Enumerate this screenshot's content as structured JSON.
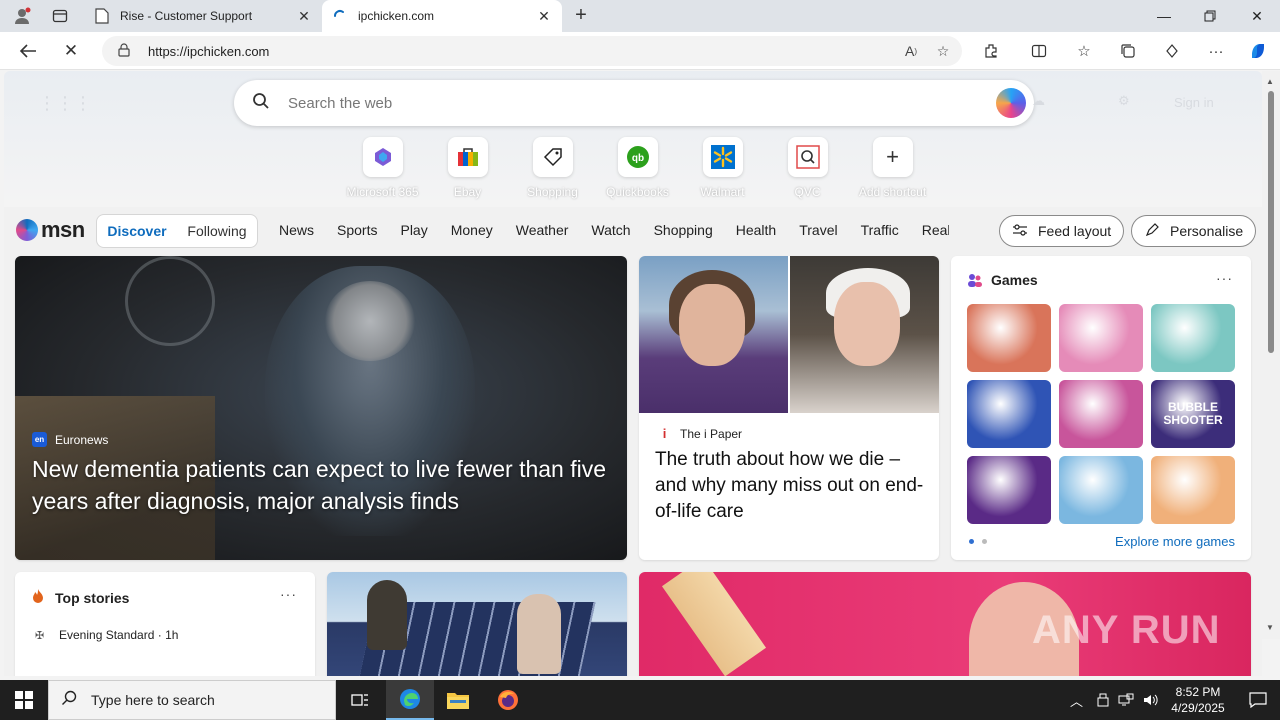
{
  "browser": {
    "tabs": [
      {
        "title": "Rise - Customer Support",
        "active": false
      },
      {
        "title": "ipchicken.com",
        "active": true
      }
    ],
    "url": "https://ipchicken.com"
  },
  "newtab": {
    "search_placeholder": "Search the web",
    "weather_faded": "Sign in",
    "shortcuts": [
      {
        "label": "Microsoft 365",
        "icon": "microsoft365-icon"
      },
      {
        "label": "Ebay",
        "icon": "ebay-icon"
      },
      {
        "label": "Shopping",
        "icon": "shopping-tag-icon"
      },
      {
        "label": "Quickbooks",
        "icon": "quickbooks-icon"
      },
      {
        "label": "Walmart",
        "icon": "walmart-icon"
      },
      {
        "label": "QVC",
        "icon": "qvc-icon"
      },
      {
        "label": "Add shortcut",
        "icon": "plus-icon"
      }
    ]
  },
  "msn": {
    "logo_text": "msn",
    "toggle": [
      "Discover",
      "Following"
    ],
    "nav": [
      "News",
      "Sports",
      "Play",
      "Money",
      "Weather",
      "Watch",
      "Shopping",
      "Health",
      "Travel",
      "Traffic",
      "Real E"
    ],
    "feed_layout": "Feed layout",
    "personalise": "Personalise"
  },
  "cards": {
    "hero": {
      "source": "Euronews",
      "title": "New dementia patients can expect to live fewer than five years after diagnosis, major analysis finds"
    },
    "ipaper": {
      "source": "The i Paper",
      "title": "The truth about how we die – and why many miss out on end-of-life care"
    },
    "games": {
      "title": "Games",
      "tiles": [
        {
          "label": "",
          "color": "#d9745a"
        },
        {
          "label": "",
          "color": "#e58bb8"
        },
        {
          "label": "",
          "color": "#7cc7c2"
        },
        {
          "label": "",
          "color": "#2f54b5"
        },
        {
          "label": "",
          "color": "#c8559b"
        },
        {
          "label": "BUBBLE SHOOTER",
          "color": "#3c2d7a"
        },
        {
          "label": "",
          "color": "#5a2a86"
        },
        {
          "label": "",
          "color": "#7bb7e0"
        },
        {
          "label": "",
          "color": "#f0b07a"
        }
      ],
      "explore": "Explore more games"
    },
    "top_stories": {
      "title": "Top stories",
      "source": "Evening Standard · 1h"
    }
  },
  "watermark": "ANY RUN",
  "taskbar": {
    "search_placeholder": "Type here to search",
    "time": "8:52 PM",
    "date": "4/29/2025"
  }
}
